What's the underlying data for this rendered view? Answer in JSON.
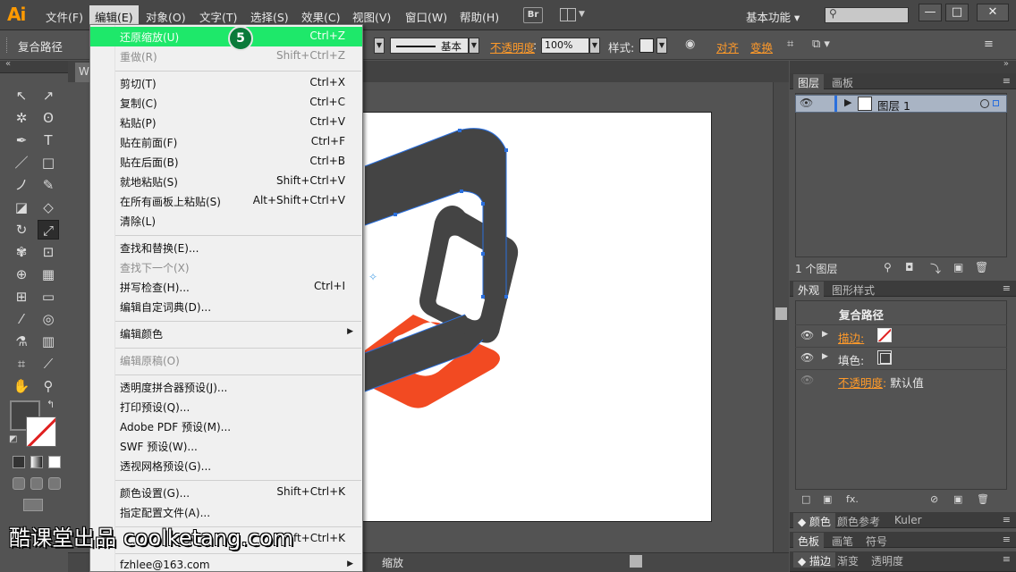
{
  "app": {
    "logo": "Ai",
    "workspace": "基本功能"
  },
  "menubar": [
    {
      "label": "文件(F)"
    },
    {
      "label": "编辑(E)"
    },
    {
      "label": "对象(O)"
    },
    {
      "label": "文字(T)"
    },
    {
      "label": "选择(S)"
    },
    {
      "label": "效果(C)"
    },
    {
      "label": "视图(V)"
    },
    {
      "label": "窗口(W)"
    },
    {
      "label": "帮助(H)"
    }
  ],
  "bridge_button": "Br",
  "window_controls": {
    "minimize": "—",
    "restore": "□",
    "close": "✕"
  },
  "controlbar": {
    "selection_label": "复合路径",
    "stroke_style": "基本",
    "opacity_label": "不透明度",
    "opacity_value": "100%",
    "style_label": "样式",
    "align_label": "对齐",
    "transform_label": "变换"
  },
  "document": {
    "tab_label": "W",
    "status_text": "缩放"
  },
  "edit_menu": {
    "step_badge": "5",
    "items": [
      {
        "label": "还原缩放(U)",
        "shortcut": "Ctrl+Z"
      },
      {
        "label": "重做(R)",
        "shortcut": "Shift+Ctrl+Z"
      },
      {
        "label": "剪切(T)",
        "shortcut": "Ctrl+X"
      },
      {
        "label": "复制(C)",
        "shortcut": "Ctrl+C"
      },
      {
        "label": "粘贴(P)",
        "shortcut": "Ctrl+V"
      },
      {
        "label": "贴在前面(F)",
        "shortcut": "Ctrl+F"
      },
      {
        "label": "贴在后面(B)",
        "shortcut": "Ctrl+B"
      },
      {
        "label": "就地粘贴(S)",
        "shortcut": "Shift+Ctrl+V"
      },
      {
        "label": "在所有画板上粘贴(S)",
        "shortcut": "Alt+Shift+Ctrl+V"
      },
      {
        "label": "清除(L)",
        "shortcut": ""
      },
      {
        "label": "查找和替换(E)...",
        "shortcut": ""
      },
      {
        "label": "查找下一个(X)",
        "shortcut": ""
      },
      {
        "label": "拼写检查(H)...",
        "shortcut": "Ctrl+I"
      },
      {
        "label": "编辑自定词典(D)...",
        "shortcut": ""
      },
      {
        "label": "编辑颜色",
        "shortcut": ""
      },
      {
        "label": "编辑原稿(O)",
        "shortcut": ""
      },
      {
        "label": "透明度拼合器预设(J)...",
        "shortcut": ""
      },
      {
        "label": "打印预设(Q)...",
        "shortcut": ""
      },
      {
        "label": "Adobe PDF 预设(M)...",
        "shortcut": ""
      },
      {
        "label": "SWF 预设(W)...",
        "shortcut": ""
      },
      {
        "label": "透视网格预设(G)...",
        "shortcut": ""
      },
      {
        "label": "颜色设置(G)...",
        "shortcut": "Shift+Ctrl+K"
      },
      {
        "label": "指定配置文件(A)...",
        "shortcut": ""
      },
      {
        "label": "",
        "shortcut": "ft+Ctrl+K"
      },
      {
        "label": "fzhlee@163.com",
        "shortcut": ""
      }
    ]
  },
  "layers_panel": {
    "tabs": [
      "图层",
      "画板"
    ],
    "layer_name": "图层 1",
    "count": "1 个图层"
  },
  "appearance_panel": {
    "tabs": [
      "外观",
      "图形样式"
    ],
    "title": "复合路径",
    "stroke_label": "描边",
    "fill_label": "填色",
    "opacity_label": "不透明度",
    "opacity_value": "默认值"
  },
  "color_panels": {
    "row1": [
      "颜色",
      "颜色参考",
      "Kuler"
    ],
    "row2": [
      "色板",
      "画笔",
      "符号"
    ],
    "row3": [
      "描边",
      "渐变",
      "透明度"
    ]
  },
  "colors": {
    "accent_orange": "#ff9a2a",
    "menu_highlight": "#1ee86a",
    "artwork_dark": "#444444",
    "artwork_orange": "#f24a22",
    "selection_blue": "#2a6fdd"
  },
  "watermark": "酷课堂出品 coolketang.com"
}
